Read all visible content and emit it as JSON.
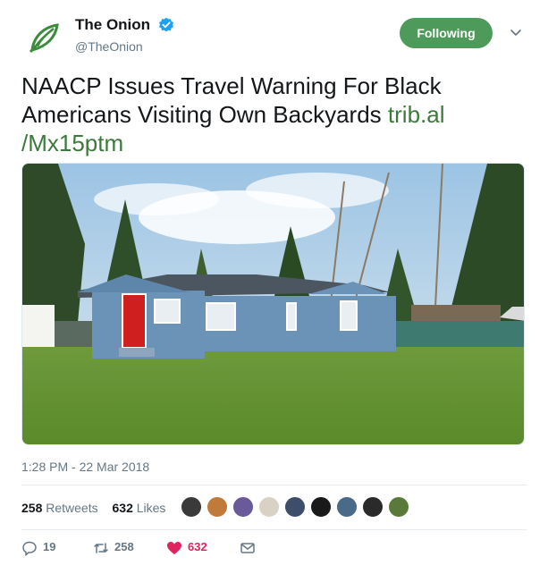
{
  "account": {
    "display_name": "The Onion",
    "handle": "@TheOnion",
    "verified": true,
    "logo_icon": "onion-logo-icon",
    "brand_color": "#4e9a5a"
  },
  "header": {
    "follow_label": "Following",
    "menu_icon": "chevron-down-icon"
  },
  "tweet": {
    "text": "NAACP Issues Travel Warning For Black Americans Visiting Own Backyards ",
    "link_part1": "trib.al",
    "link_part2": "/Mx15ptm",
    "photo_icon": "photo-house-backyard",
    "timestamp": "1:28 PM - 22 Mar 2018"
  },
  "stats": {
    "retweets_count": "258",
    "retweets_label": "Retweets",
    "likes_count": "632",
    "likes_label": "Likes",
    "avatar_colors": [
      "#3a3a3a",
      "#c07a3a",
      "#6a5a9a",
      "#d9d2c4",
      "#3d4d6a",
      "#1a1a1a",
      "#4a6a8a",
      "#2a2a2a",
      "#5a7a3a"
    ]
  },
  "actions": {
    "reply_icon": "reply-icon",
    "reply_count": "19",
    "retweet_icon": "retweet-icon",
    "retweet_count": "258",
    "like_icon": "heart-icon",
    "like_count": "632",
    "like_color": "#e0245e",
    "dm_icon": "envelope-icon"
  }
}
